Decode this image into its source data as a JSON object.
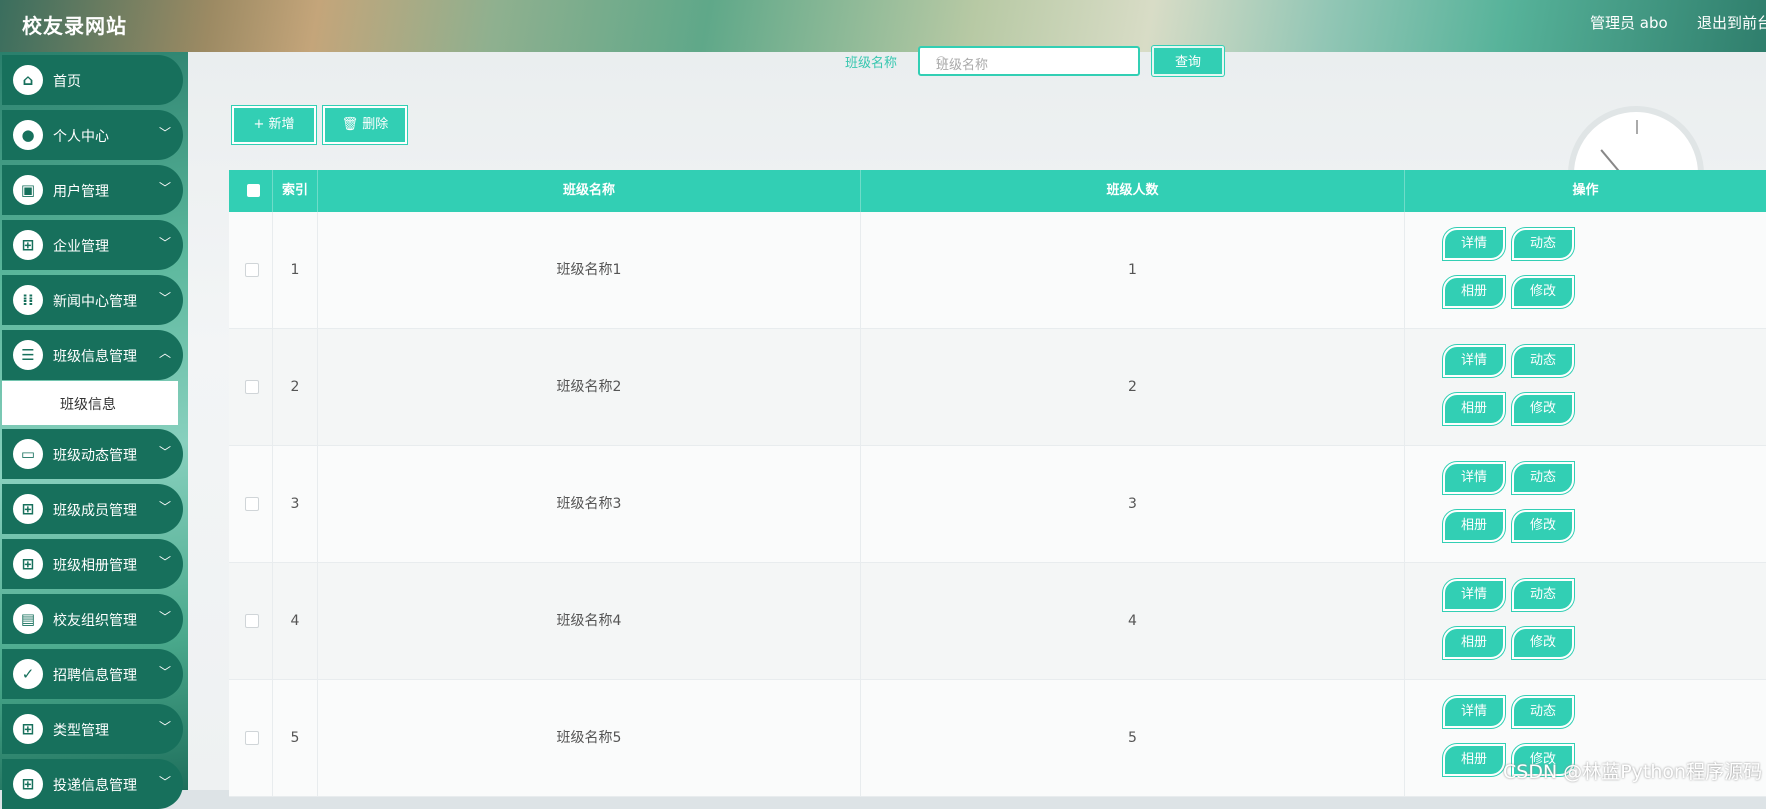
{
  "header": {
    "title": "校友录网站",
    "admin": "管理员 abo",
    "logout": "退出到前台"
  },
  "sidebar": {
    "items": [
      {
        "label": "首页",
        "icon": "home-icon"
      },
      {
        "label": "个人中心",
        "icon": "user-icon"
      },
      {
        "label": "用户管理",
        "icon": "user-manage-icon"
      },
      {
        "label": "企业管理",
        "icon": "grid-icon"
      },
      {
        "label": "新闻中心管理",
        "icon": "apps-icon"
      },
      {
        "label": "班级信息管理",
        "icon": "list-icon"
      },
      {
        "label": "班级动态管理",
        "icon": "monitor-icon"
      },
      {
        "label": "班级成员管理",
        "icon": "grid-icon"
      },
      {
        "label": "班级相册管理",
        "icon": "grid-icon"
      },
      {
        "label": "校友组织管理",
        "icon": "wallet-icon"
      },
      {
        "label": "招聘信息管理",
        "icon": "clipboard-icon"
      },
      {
        "label": "类型管理",
        "icon": "grid-icon"
      },
      {
        "label": "投递信息管理",
        "icon": "grid-icon"
      }
    ],
    "submenu": "班级信息"
  },
  "search": {
    "label": "班级名称",
    "placeholder": "班级名称",
    "button": "查询"
  },
  "toolbar": {
    "add": "+ 新增",
    "delete": "🗑 删除"
  },
  "table": {
    "headers": [
      "索引",
      "班级名称",
      "班级人数",
      "操作"
    ],
    "rows": [
      {
        "index": "1",
        "name": "班级名称1",
        "count": "1"
      },
      {
        "index": "2",
        "name": "班级名称2",
        "count": "2"
      },
      {
        "index": "3",
        "name": "班级名称3",
        "count": "3"
      },
      {
        "index": "4",
        "name": "班级名称4",
        "count": "4"
      },
      {
        "index": "5",
        "name": "班级名称5",
        "count": "5"
      }
    ],
    "actions": [
      "详情",
      "动态",
      "相册",
      "修改"
    ]
  },
  "watermark": "CSDN @林蓝Python程序源码"
}
